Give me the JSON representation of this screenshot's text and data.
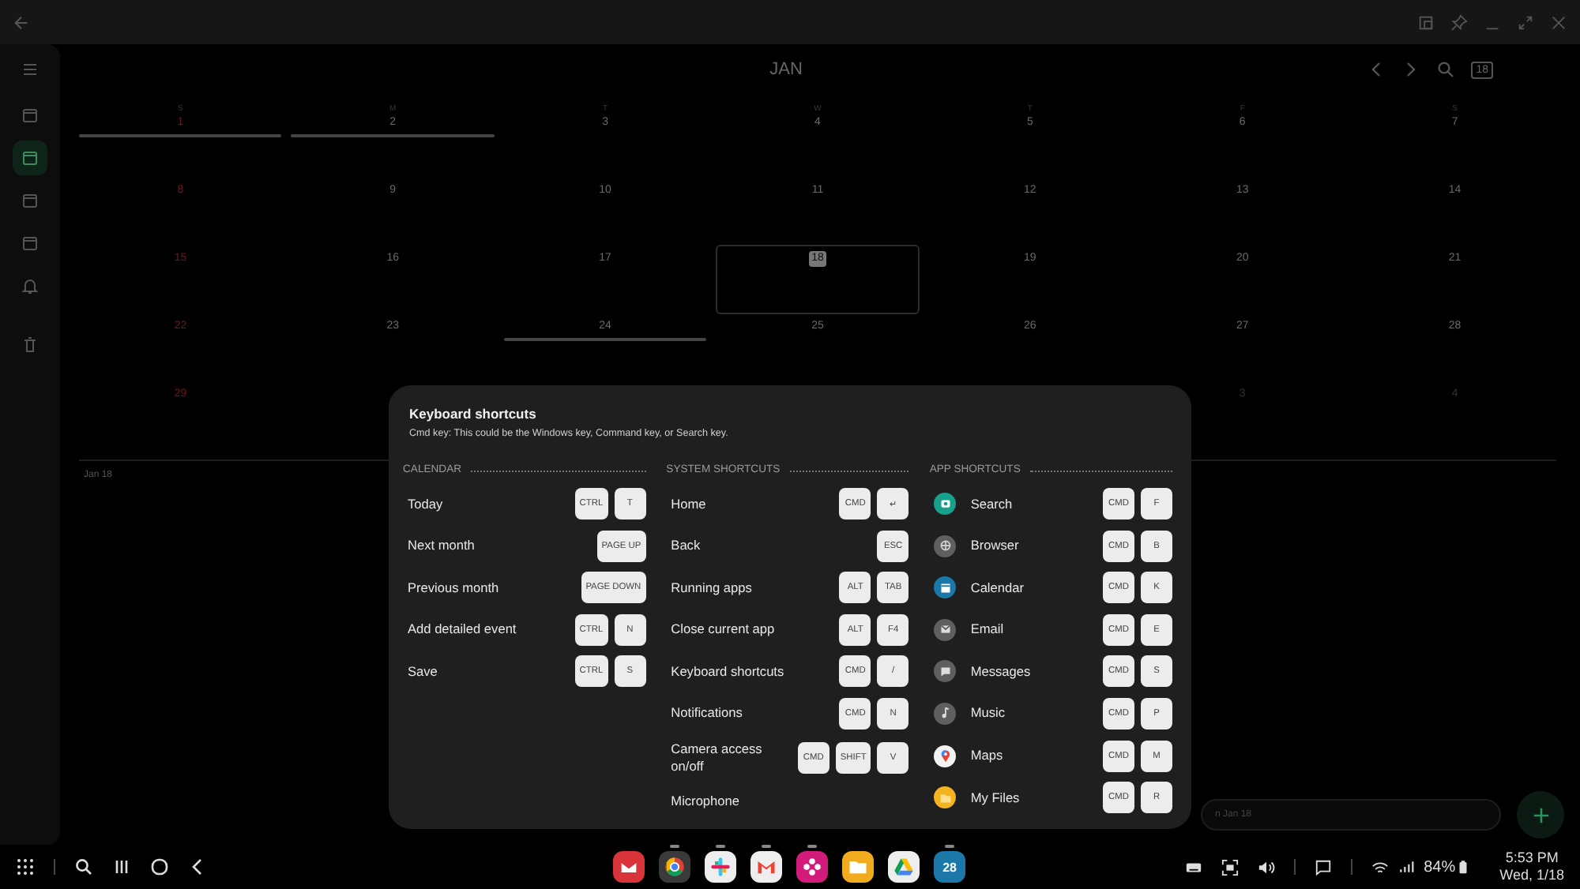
{
  "calendar": {
    "month": "JAN",
    "today_badge": "18",
    "weekdays": [
      "S",
      "M",
      "T",
      "W",
      "T",
      "F",
      "S"
    ],
    "weeks": [
      {
        "start": [
          {
            "day": "1",
            "holiday": true,
            "event": true,
            "other_month": false
          },
          {
            "day": "2",
            "holiday": false,
            "event": true,
            "other_month": false
          },
          {
            "day": "3",
            "holiday": false,
            "other_month": false
          },
          {
            "day": "4",
            "holiday": false,
            "other_month": false
          },
          {
            "day": "5",
            "holiday": false,
            "other_month": false
          },
          {
            "day": "6",
            "holiday": false,
            "other_month": false
          },
          {
            "day": "7",
            "holiday": false,
            "other_month": false
          }
        ]
      },
      {
        "start": [
          {
            "day": "8",
            "holiday": true,
            "other_month": false
          },
          {
            "day": "9",
            "holiday": false,
            "other_month": false
          },
          {
            "day": "10",
            "holiday": false,
            "other_month": false
          },
          {
            "day": "11",
            "holiday": false,
            "other_month": false
          },
          {
            "day": "12",
            "holiday": false,
            "other_month": false
          },
          {
            "day": "13",
            "holiday": false,
            "other_month": false
          },
          {
            "day": "14",
            "holiday": false,
            "other_month": false
          }
        ]
      },
      {
        "start": [
          {
            "day": "15",
            "holiday": true,
            "other_month": false
          },
          {
            "day": "16",
            "holiday": false,
            "other_month": false
          },
          {
            "day": "17",
            "holiday": false,
            "other_month": false
          },
          {
            "day": "18",
            "holiday": false,
            "today": true,
            "other_month": false
          },
          {
            "day": "19",
            "holiday": false,
            "other_month": false
          },
          {
            "day": "20",
            "holiday": false,
            "other_month": false
          },
          {
            "day": "21",
            "holiday": false,
            "other_month": false
          }
        ]
      },
      {
        "start": [
          {
            "day": "22",
            "holiday": true,
            "other_month": false
          },
          {
            "day": "23",
            "holiday": false,
            "other_month": false
          },
          {
            "day": "24",
            "holiday": false,
            "event": true,
            "other_month": false
          },
          {
            "day": "25",
            "holiday": false,
            "other_month": false
          },
          {
            "day": "26",
            "holiday": false,
            "other_month": false
          },
          {
            "day": "27",
            "holiday": false,
            "other_month": false
          },
          {
            "day": "28",
            "holiday": false,
            "other_month": false
          }
        ]
      },
      {
        "start": [
          {
            "day": "29",
            "holiday": true,
            "other_month": false
          }
        ],
        "end": [
          {
            "day": "3",
            "holiday": false,
            "other_month": true
          },
          {
            "day": "4",
            "holiday": false,
            "other_month": true
          }
        ]
      }
    ],
    "selected_date": "Jan 18",
    "add_field": {
      "placeholder": "n Jan 18"
    }
  },
  "sidebar": {
    "items": [
      {
        "selected": false
      },
      {
        "selected": true
      },
      {
        "selected": false
      },
      {
        "selected": false
      },
      {
        "selected": false
      },
      {
        "selected": false
      }
    ]
  },
  "dialog": {
    "title": "Keyboard shortcuts",
    "subtitle": "Cmd key: This could be the Windows key, Command key, or Search key.",
    "sections": [
      {
        "title": "CALENDAR",
        "rows": [
          {
            "label": "Today",
            "keys": [
              "CTRL",
              "T"
            ]
          },
          {
            "label": "Next month",
            "keys": [
              "PAGE UP"
            ]
          },
          {
            "label": "Previous month",
            "keys": [
              "PAGE DOWN"
            ]
          },
          {
            "label": "Add detailed event",
            "keys": [
              "CTRL",
              "N"
            ]
          },
          {
            "label": "Save",
            "keys": [
              "CTRL",
              "S"
            ]
          }
        ]
      },
      {
        "title": "SYSTEM SHORTCUTS",
        "rows": [
          {
            "label": "Home",
            "keys": [
              "CMD",
              "↵"
            ]
          },
          {
            "label": "Back",
            "keys": [
              "ESC"
            ]
          },
          {
            "label": "Running apps",
            "keys": [
              "ALT",
              "TAB"
            ]
          },
          {
            "label": "Close current app",
            "keys": [
              "ALT",
              "F4"
            ]
          },
          {
            "label": "Keyboard shortcuts",
            "keys": [
              "CMD",
              "/"
            ]
          },
          {
            "label": "Notifications",
            "keys": [
              "CMD",
              "N"
            ]
          },
          {
            "label": "Camera access on/off",
            "keys": [
              "CMD",
              "SHIFT",
              "V"
            ]
          },
          {
            "label": "Microphone",
            "keys": []
          }
        ]
      },
      {
        "title": "APP SHORTCUTS",
        "rows": [
          {
            "label": "Search",
            "keys": [
              "CMD",
              "F"
            ],
            "color": "#17a08c"
          },
          {
            "label": "Browser",
            "keys": [
              "CMD",
              "B"
            ],
            "color": "#5f5f5f"
          },
          {
            "label": "Calendar",
            "keys": [
              "CMD",
              "K"
            ],
            "color": "#1b78a8"
          },
          {
            "label": "Email",
            "keys": [
              "CMD",
              "E"
            ],
            "color": "#5f5f5f"
          },
          {
            "label": "Messages",
            "keys": [
              "CMD",
              "S"
            ],
            "color": "#5f5f5f"
          },
          {
            "label": "Music",
            "keys": [
              "CMD",
              "P"
            ],
            "color": "#5f5f5f"
          },
          {
            "label": "Maps",
            "keys": [
              "CMD",
              "M"
            ],
            "color": "#f2f2f2"
          },
          {
            "label": "My Files",
            "keys": [
              "CMD",
              "R"
            ],
            "color": "#f4b321"
          }
        ]
      }
    ]
  },
  "taskbar": {
    "apps": [
      {
        "color": "#d9343a"
      },
      {
        "running": true,
        "color": "#3a3a3a"
      },
      {
        "running": true,
        "color": "#eeeeee"
      },
      {
        "running": true,
        "color": "#eeeeee"
      },
      {
        "running": true,
        "color": "#d21b7a"
      },
      {
        "color": "#f2aa1f"
      },
      {
        "color": "#eeeeee"
      },
      {
        "running": true,
        "color": "#1b78a8",
        "label": "28"
      }
    ],
    "battery": "84%",
    "time": "5:53 PM",
    "date": "Wed, 1/18"
  }
}
